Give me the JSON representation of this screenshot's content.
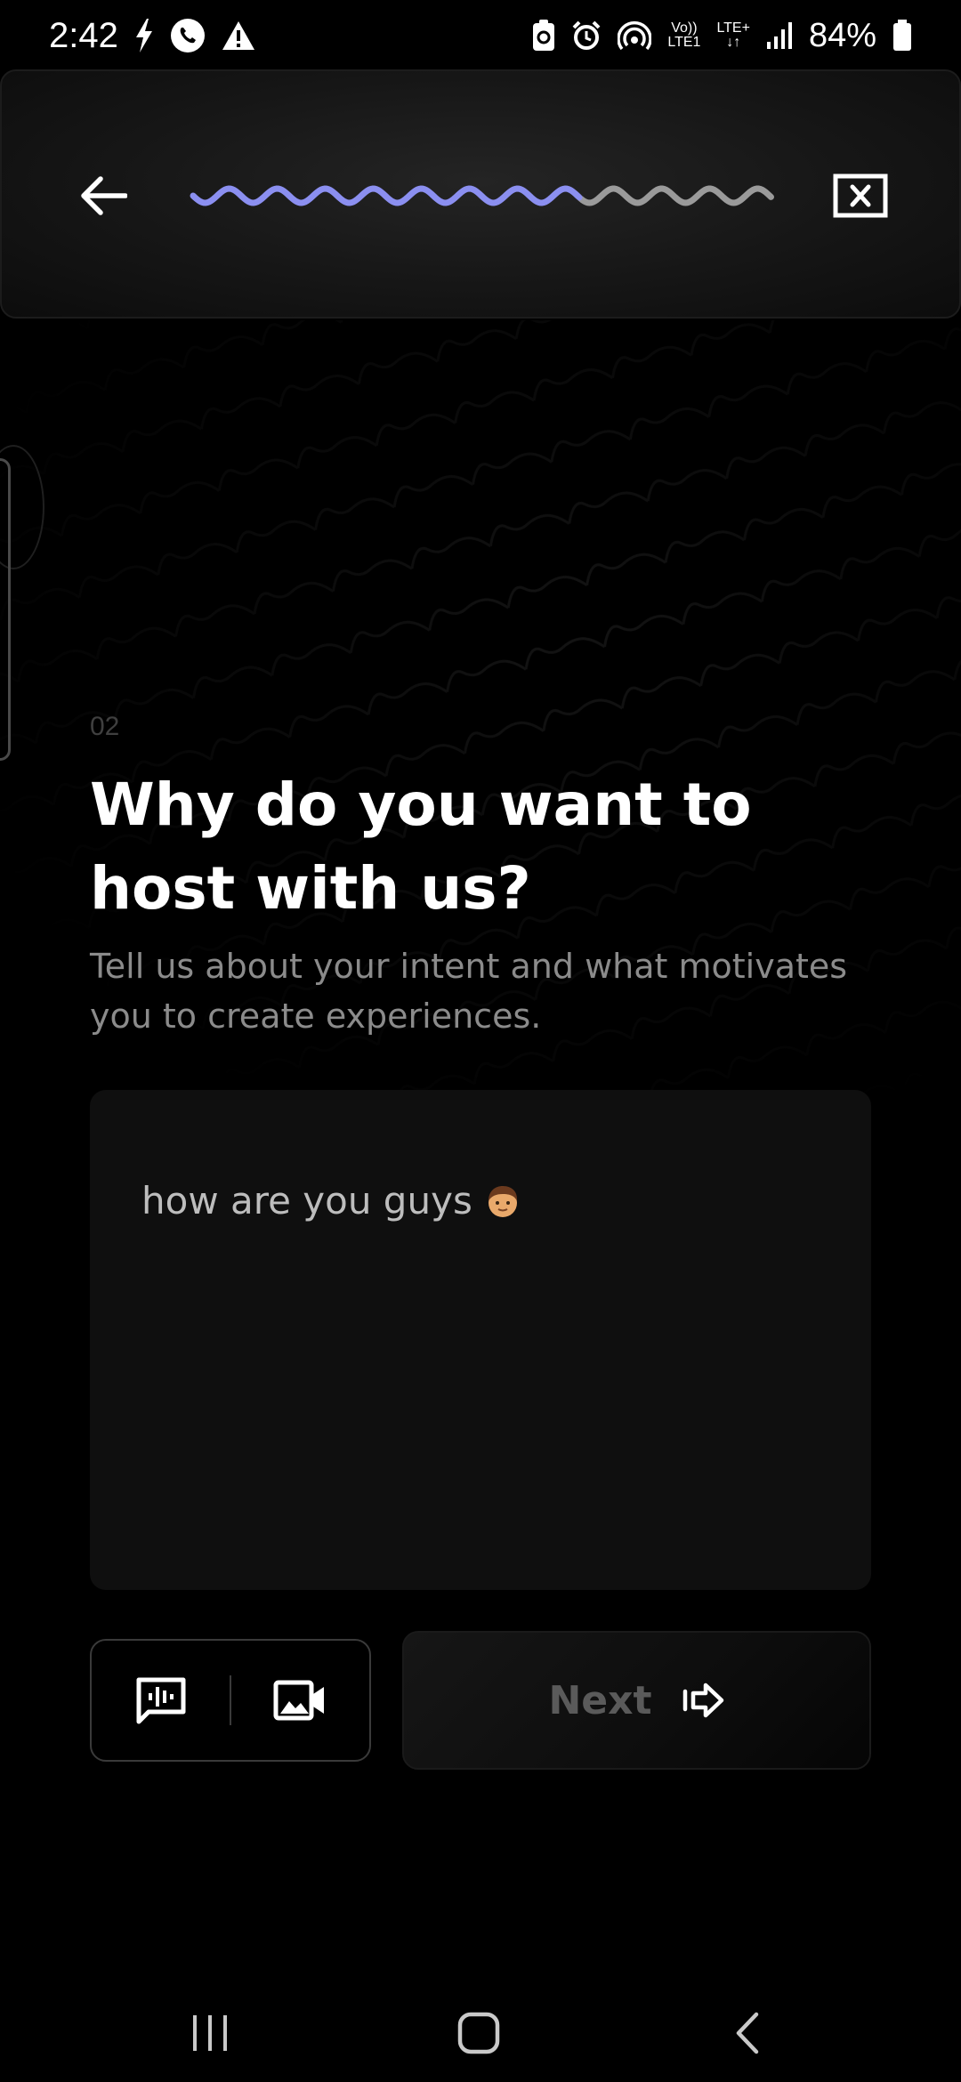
{
  "status_bar": {
    "time": "2:42",
    "battery_percent": "84%",
    "network_top": "LTE+",
    "volte_top": "Vo))",
    "volte_bottom": "LTE1",
    "icons": [
      "flash-icon",
      "call-icon",
      "alert-icon",
      "screenshot-icon",
      "alarm-icon",
      "hotspot-icon",
      "signal-icon",
      "battery-icon"
    ]
  },
  "header": {
    "progress_fraction": 0.67,
    "progress_active_color": "#8b8ff0",
    "progress_inactive_color": "#9a9a9a"
  },
  "question": {
    "step_number": "02",
    "title": "Why do you want to host with us?",
    "subtitle": "Tell us about your intent and what motivates you to create experiences."
  },
  "answer": {
    "text": "how are you guys",
    "emoji": "boy-emoji"
  },
  "actions": {
    "next_label": "Next"
  },
  "colors": {
    "background": "#000000",
    "accent": "#8b8ff0",
    "muted_text": "#8b8b8b"
  }
}
